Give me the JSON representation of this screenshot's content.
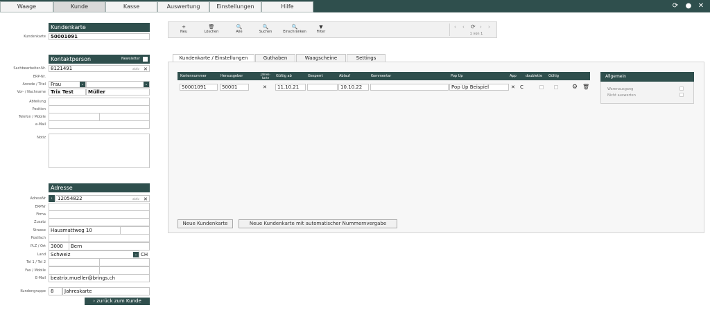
{
  "nav": {
    "tabs": [
      "Waage",
      "Kunde",
      "Kasse",
      "Auswertung",
      "Einstellungen",
      "Hilfe"
    ],
    "active": "Kunde",
    "icons": [
      "refresh-icon",
      "user-icon",
      "close-icon"
    ]
  },
  "kundenkarte": {
    "title": "Kundenkarte",
    "label": "Kundenkarte",
    "value": "50001091"
  },
  "kontakt": {
    "title": "Kontaktperson",
    "newsletter_label": "Newsletter",
    "labels": {
      "sachbearbeiter": "Sachbearbeiter-Nr.",
      "erp": "ERP-Nr.",
      "anrede": "Anrede / Titel",
      "name": "Vor- / Nachname",
      "abteilung": "Abteilung",
      "position": "Position",
      "telefon": "Telefon / Mobile",
      "email": "e-Mail",
      "notiz": "Notiz"
    },
    "sachbearbeiter_value": "8121491",
    "aktiv": "aktiv",
    "anrede_value": "Frau",
    "vorname": "Trix Test",
    "nachname": "Müller"
  },
  "adresse": {
    "title": "Adresse",
    "labels": {
      "adressnr": "AdressNr",
      "erpnr": "ERPNr",
      "firma": "Firma",
      "zusatz": "Zusatz",
      "strasse": "Strasse",
      "postfach": "Postfach",
      "plz": "PLZ / Ort",
      "land": "Land",
      "tel": "Tel 1 / Tel 2",
      "fax": "Fax / Mobile",
      "email": "E-Mail"
    },
    "adressnr_value": "12054822",
    "aktiv": "aktiv",
    "strasse_value": "Hausmattweg 10",
    "plz_value": "3000",
    "ort_value": "Bern",
    "land_value": "Schweiz",
    "land_code": "CH",
    "email_value": "beatrix.mueller@brings.ch"
  },
  "kundengruppe": {
    "label": "Kundengruppe",
    "code": "8",
    "name": "Jahreskarte"
  },
  "back_button": "zurück zum Kunde",
  "toolbar": {
    "buttons": [
      {
        "label": "Neu",
        "icon": "+"
      },
      {
        "label": "Löschen",
        "icon": "🗑"
      },
      {
        "label": "Alle",
        "icon": "🔍"
      },
      {
        "label": "Suchen",
        "icon": "🔍"
      },
      {
        "label": "Einschränken",
        "icon": "🔍"
      },
      {
        "label": "Filter",
        "icon": "▼"
      }
    ],
    "pager": "1 von 1"
  },
  "content_tabs": [
    "Kundenkarte / Einstellungen",
    "Guthaben",
    "Waagscheine",
    "Settings"
  ],
  "table": {
    "headers": {
      "kartennummer": "Kartennummer",
      "herausgeber": "Herausgeber",
      "jahreskarte": "Jahres-\nkarte",
      "gueltig_ab": "Gültig ab",
      "gesperrt": "Gesperrt",
      "ablauf": "Ablauf",
      "kommentar": "Kommentar",
      "popup": "Pop Up",
      "app": "App",
      "doublette": "doublette",
      "gueltig": "Gültig"
    },
    "row": {
      "kartennummer": "50001091",
      "herausgeber": "50001",
      "jahreskarte": "✕",
      "gueltig_ab": "11.10.21",
      "gesperrt": "",
      "ablauf": "10.10.22",
      "kommentar": "",
      "popup": "Pop Up Beispiel",
      "app": "✕",
      "app2": "C"
    }
  },
  "buttons": {
    "neue_kundenkarte": "Neue Kundenkarte",
    "neue_auto": "Neue Kundenkarte mit automatischer Nummernvergabe"
  },
  "allgemein": {
    "title": "Allgemein",
    "warenausgang": "Warenausgang",
    "nicht_auswerten": "Nicht auswerten"
  }
}
